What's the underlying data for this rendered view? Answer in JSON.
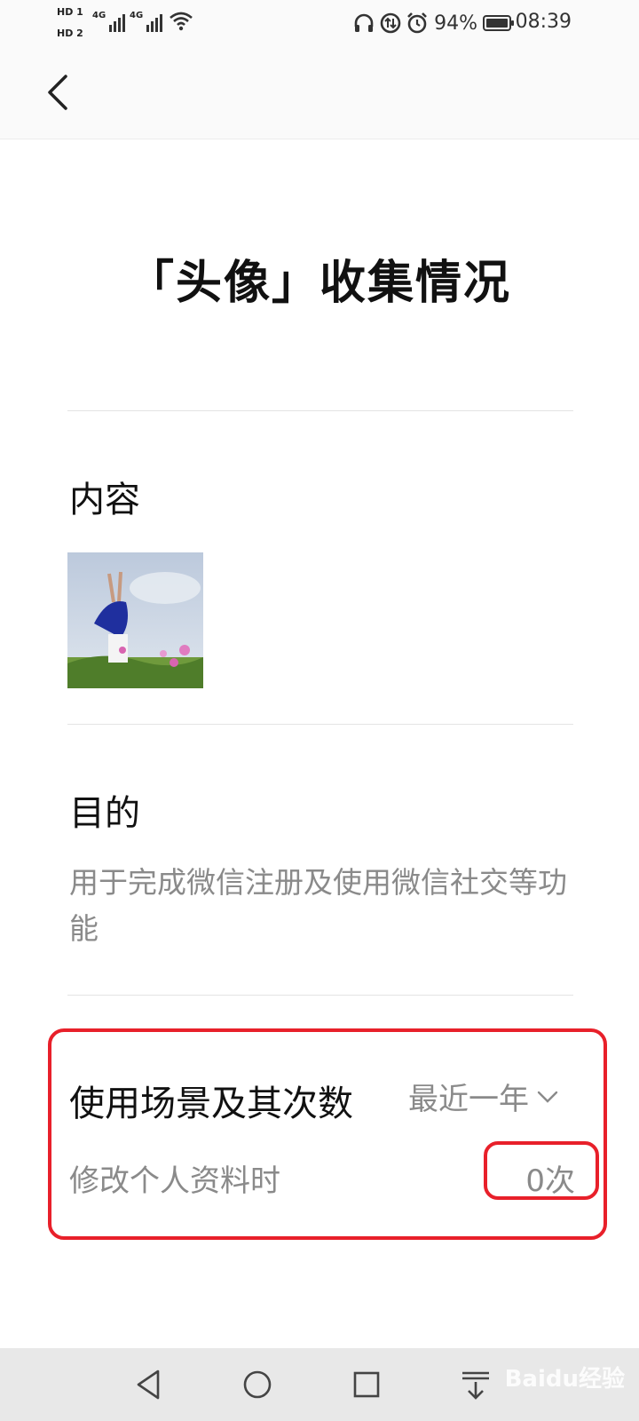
{
  "status_bar": {
    "sim1": "HD 1",
    "sim2": "HD 2",
    "network1": "4G",
    "network2": "4G",
    "battery_percent": "94%",
    "time": "08:39"
  },
  "page": {
    "title": "「头像」收集情况"
  },
  "content_section": {
    "heading": "内容"
  },
  "purpose_section": {
    "heading": "目的",
    "text": "用于完成微信注册及使用微信社交等功能"
  },
  "usage_section": {
    "heading": "使用场景及其次数",
    "period": "最近一年",
    "rows": [
      {
        "label": "修改个人资料时",
        "count": "0次"
      }
    ]
  },
  "watermark": "Baidu经验",
  "icons": {
    "back": "chevron-left-icon",
    "dropdown": "chevron-down-icon",
    "nav_back": "triangle-back-icon",
    "nav_home": "circle-home-icon",
    "nav_recent": "square-recent-icon",
    "nav_notify": "notification-pull-icon"
  },
  "colors": {
    "highlight": "#e8202a",
    "secondary_text": "#8a8a8a"
  }
}
